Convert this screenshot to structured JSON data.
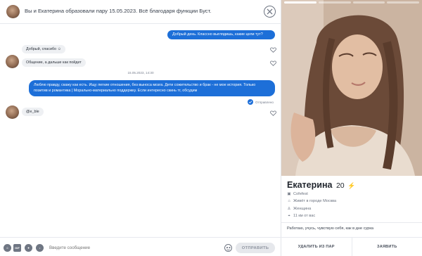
{
  "chat": {
    "header_title": "Вы и Екатерина образовали пару 15.05.2023. Всё благодаря функции Буст.",
    "messages_out": [
      "Добрый день. Классно выглядишь, какие цели тут?",
      "Люблю правду, скажу как есть. Ищу легкие отношения, без выноса мозга. Дети сожительство и брак - не мое история. Только позитив и романтика | Морально-материально поддержку. Если интересно скинь тг, обсудим"
    ],
    "messages_in": [
      "Добрый, спасибо ☺",
      "Общение, а дальше как пойдет",
      "@e_ble"
    ],
    "datestamp": "15.05.2023, 14:30",
    "sent_status": "Отправлено"
  },
  "composer": {
    "placeholder": "Введите сообщение",
    "send_label": "ОТПРАВИТЬ",
    "tools": [
      "sticker-icon",
      "gif-icon",
      "sticker-icon",
      "music-icon"
    ],
    "gif_label": "GIF"
  },
  "profile": {
    "name": "Екатерина",
    "age": "20",
    "workplace": "Cofefest",
    "city": "Живёт в городе Москва",
    "gender": "Женщина",
    "distance": "11 км от вас",
    "bio": "Работаю, учусь, чувствую себя, как в дне сурка",
    "unmatch_label": "УДАЛИТЬ ИЗ ПАР",
    "report_label": "ЗАЯВИТЬ",
    "photo_count": 4,
    "active_photo": 1
  },
  "colors": {
    "accent": "#1d6fd8",
    "boost": "#a64dff",
    "bubble_in": "#eef0f3"
  }
}
